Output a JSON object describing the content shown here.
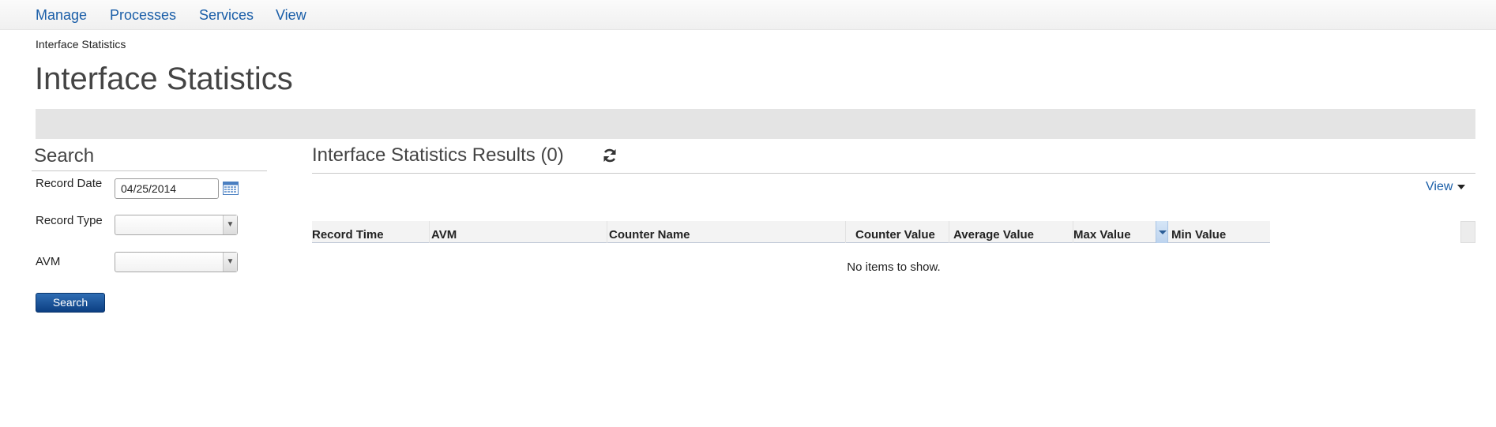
{
  "nav": {
    "items": [
      "Manage",
      "Processes",
      "Services",
      "View"
    ]
  },
  "breadcrumb": "Interface Statistics",
  "page_title": "Interface Statistics",
  "search": {
    "title": "Search",
    "record_date_label": "Record Date",
    "record_date_value": "04/25/2014",
    "record_type_label": "Record Type",
    "record_type_value": "",
    "avm_label": "AVM",
    "avm_value": "",
    "button_label": "Search"
  },
  "results": {
    "title": "Interface Statistics Results (0)",
    "view_menu_label": "View",
    "columns": [
      "Record Time",
      "AVM",
      "Counter Name",
      "Counter Value",
      "Average Value",
      "Max Value",
      "Min Value"
    ],
    "empty_message": "No items to show."
  },
  "colors": {
    "link": "#1a5ea8",
    "button": "#0c3f83",
    "message_bar": "#e4e4e4"
  },
  "icons": {
    "calendar": "calendar-icon",
    "refresh": "refresh-icon",
    "dropdown": "chevron-down-icon"
  }
}
